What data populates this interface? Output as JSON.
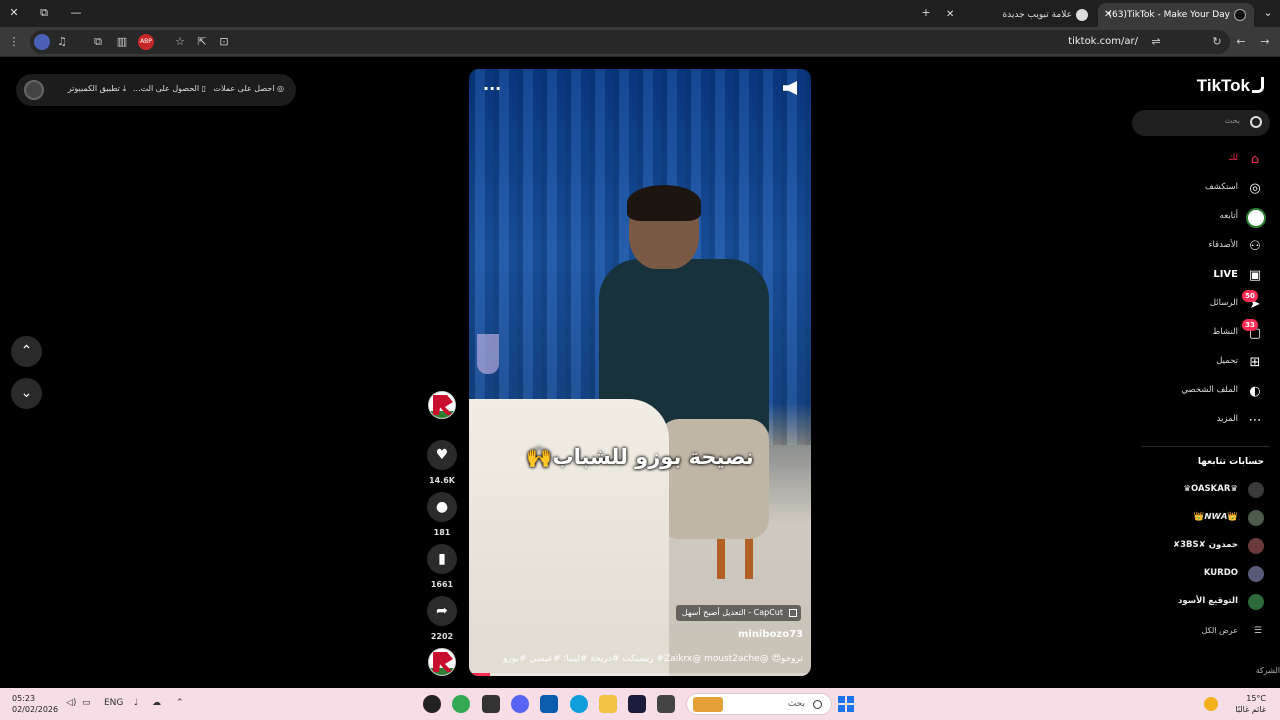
{
  "browser": {
    "tabs": [
      {
        "title": "(63)TikTok - Make Your Day",
        "active": true
      },
      {
        "title": "علامة تبويب جديدة",
        "active": false
      }
    ],
    "url": "tiktok.com/ar/",
    "controls": {
      "close": "✕",
      "restore": "⧉",
      "minimize": "—",
      "new_tab": "+",
      "menu": "⌄",
      "more": "⋮"
    }
  },
  "topbar": {
    "get_coins": "احصل على عملات",
    "get_app": "الحصول على الت...",
    "desktop_app": "تطبيق الكمبيوتر"
  },
  "video": {
    "overlay_text": "نصيحة بوزو للشباب🙌",
    "capcut_label": "CapCut - التعديل أصبح أسهل",
    "author": "minibozo73",
    "description": "تروجو😍 @Zaikrx@ moust2ache# ريسيكت #دريحة #ليبيا؛ #عبسي #بوزو",
    "progress": 0.06
  },
  "actions": {
    "likes": "14.6K",
    "comments": "181",
    "saves": "1661",
    "shares": "2202"
  },
  "sidebar": {
    "logo": "TikTok",
    "search_placeholder": "بحث",
    "nav": [
      {
        "label": "لك",
        "icon": "home-icon",
        "glyph": "⌂",
        "active": true
      },
      {
        "label": "استكشف",
        "icon": "compass-icon",
        "glyph": "◎"
      },
      {
        "label": "أتابعه",
        "icon": "following-avatar-icon",
        "glyph": ""
      },
      {
        "label": "الأصدقاء",
        "icon": "friends-icon",
        "glyph": "⚇"
      },
      {
        "label": "LIVE",
        "icon": "live-icon",
        "glyph": "▣"
      },
      {
        "label": "الرسائل",
        "icon": "messages-icon",
        "glyph": "➤",
        "badge": "50"
      },
      {
        "label": "النشاط",
        "icon": "activity-icon",
        "glyph": "▢",
        "badge": "33"
      },
      {
        "label": "تحميل",
        "icon": "upload-icon",
        "glyph": "⊞"
      },
      {
        "label": "الملف الشخصي",
        "icon": "profile-icon",
        "glyph": "◐"
      },
      {
        "label": "المزيد",
        "icon": "more-icon",
        "glyph": "⋯"
      }
    ],
    "following_title": "حسابات تتابعها",
    "following": [
      {
        "name": "♛OASKAR♛"
      },
      {
        "name": "👑𝙉𝙒𝘼👑"
      },
      {
        "name": "حمدون ✘3BS✘"
      },
      {
        "name": "KURDO"
      },
      {
        "name": "التوقيع الأسود"
      }
    ],
    "see_all": "عرض الكل",
    "company": "الشركة"
  },
  "taskbar": {
    "time": "05:23",
    "date": "02/02/2026",
    "lang": "ENG",
    "search_placeholder": "بحث",
    "temp": "15°C",
    "weather_text": "غائم غالبًا"
  },
  "colors": {
    "accent": "#fe2c55",
    "taskbar": "#f7dde6"
  }
}
